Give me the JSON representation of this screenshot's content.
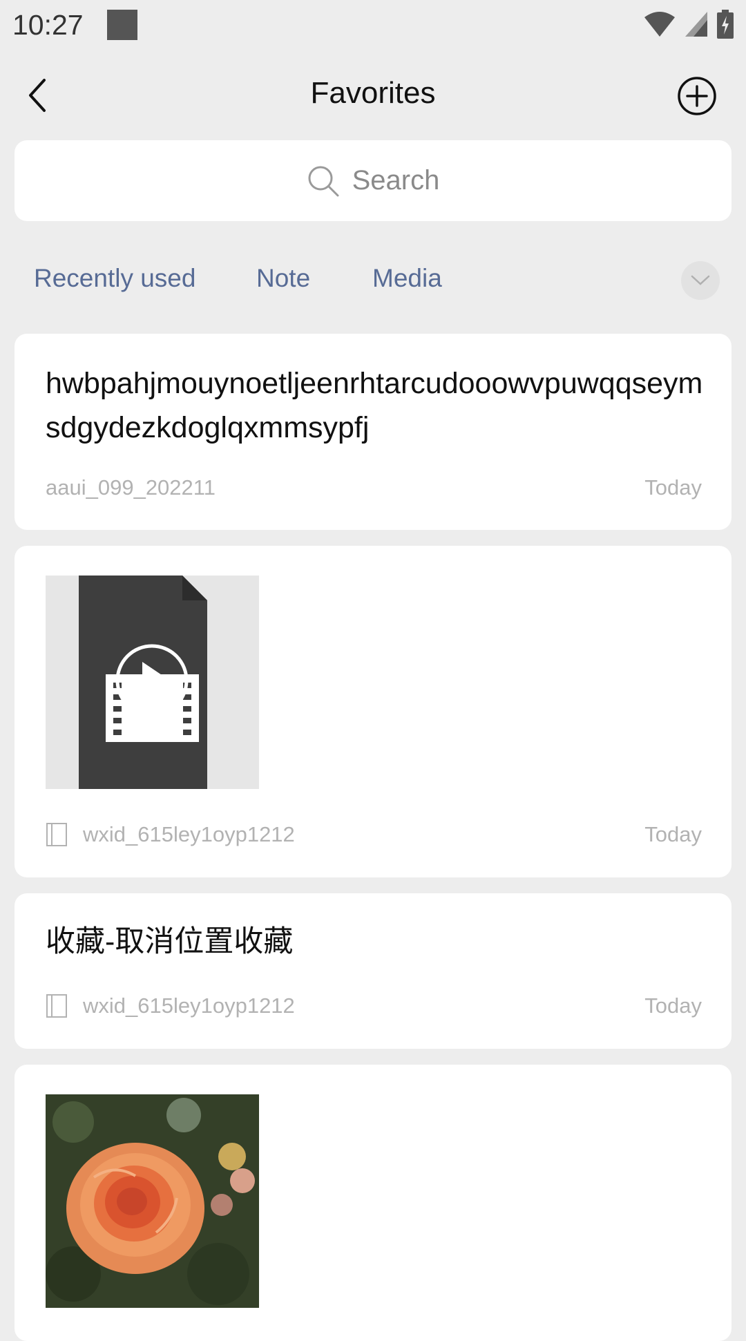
{
  "status": {
    "time": "10:27"
  },
  "header": {
    "title": "Favorites"
  },
  "search": {
    "placeholder": "Search"
  },
  "tabs": [
    {
      "label": "Recently used"
    },
    {
      "label": "Note"
    },
    {
      "label": "Media"
    }
  ],
  "items": [
    {
      "text": "hwbpahjmouynoetljeenrhtarcudooowvpuwqqseymsdgydezkdoglqxmmsypfj",
      "source": "aaui_099_202211",
      "date": "Today"
    },
    {
      "type": "video",
      "source": "wxid_615ley1oyp1212",
      "date": "Today"
    },
    {
      "text": "收藏-取消位置收藏",
      "source": "wxid_615ley1oyp1212",
      "date": "Today"
    },
    {
      "type": "image"
    }
  ]
}
